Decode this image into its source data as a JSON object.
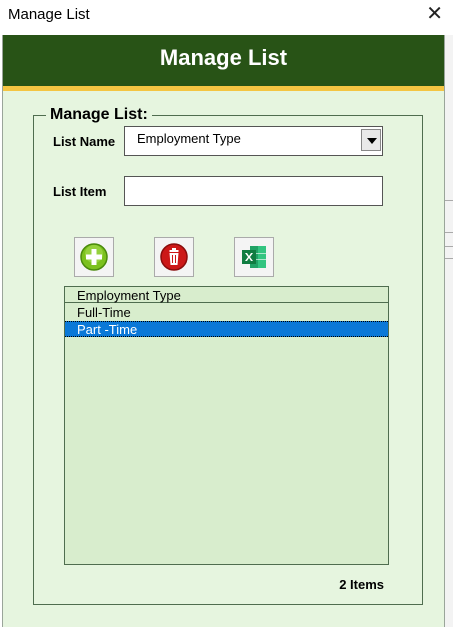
{
  "window": {
    "title": "Manage List",
    "close_glyph": "✕"
  },
  "header": {
    "title": "Manage List",
    "bg_color": "#285316",
    "stripe_color": "#f4c542"
  },
  "frame": {
    "legend": "Manage List:"
  },
  "fields": {
    "list_name_label": "List Name",
    "list_name_value": "Employment Type",
    "list_item_label": "List Item",
    "list_item_value": ""
  },
  "toolbar": {
    "buttons": [
      {
        "name": "add-item-button",
        "icon": "plus-icon"
      },
      {
        "name": "delete-item-button",
        "icon": "trash-icon"
      },
      {
        "name": "export-excel-button",
        "icon": "excel-icon"
      }
    ]
  },
  "listbox": {
    "column_header": "Employment Type",
    "items": [
      "Full-Time",
      "Part -Time"
    ],
    "selected_index": 1
  },
  "footer": {
    "count_text": "2 Items"
  }
}
